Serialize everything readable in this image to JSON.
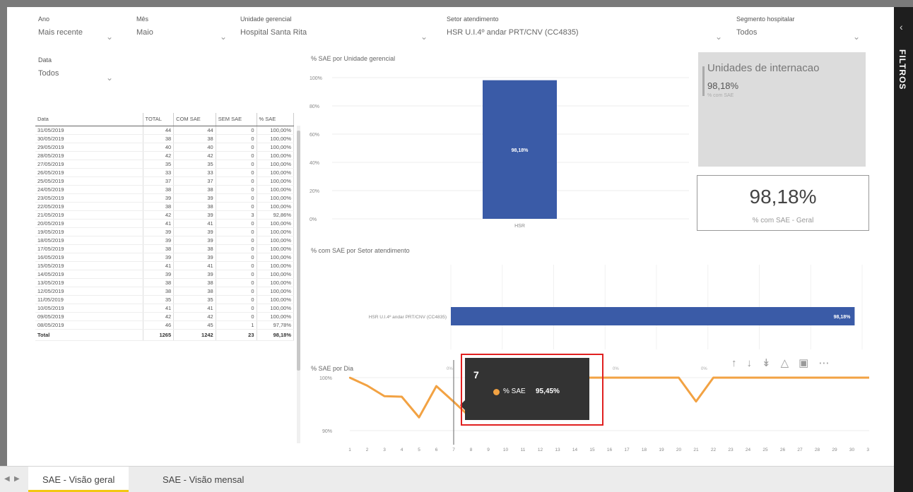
{
  "slicers": [
    {
      "label": "Ano",
      "value": "Mais recente"
    },
    {
      "label": "Mês",
      "value": "Maio"
    },
    {
      "label": "Unidade gerencial",
      "value": "Hospital Santa Rita"
    },
    {
      "label": "Setor atendimento",
      "value": "HSR U.I.4º andar PRT/CNV (CC4835)"
    },
    {
      "label": "Segmento hospitalar",
      "value": "Todos"
    },
    {
      "label": "Data",
      "value": "Todos"
    }
  ],
  "table": {
    "headers": [
      "Data",
      "TOTAL",
      "COM SAE",
      "SEM SAE",
      "% SAE"
    ],
    "rows": [
      [
        "31/05/2019",
        "44",
        "44",
        "0",
        "100,00%"
      ],
      [
        "30/05/2019",
        "38",
        "38",
        "0",
        "100,00%"
      ],
      [
        "29/05/2019",
        "40",
        "40",
        "0",
        "100,00%"
      ],
      [
        "28/05/2019",
        "42",
        "42",
        "0",
        "100,00%"
      ],
      [
        "27/05/2019",
        "35",
        "35",
        "0",
        "100,00%"
      ],
      [
        "26/05/2019",
        "33",
        "33",
        "0",
        "100,00%"
      ],
      [
        "25/05/2019",
        "37",
        "37",
        "0",
        "100,00%"
      ],
      [
        "24/05/2019",
        "38",
        "38",
        "0",
        "100,00%"
      ],
      [
        "23/05/2019",
        "39",
        "39",
        "0",
        "100,00%"
      ],
      [
        "22/05/2019",
        "38",
        "38",
        "0",
        "100,00%"
      ],
      [
        "21/05/2019",
        "42",
        "39",
        "3",
        "92,86%"
      ],
      [
        "20/05/2019",
        "41",
        "41",
        "0",
        "100,00%"
      ],
      [
        "19/05/2019",
        "39",
        "39",
        "0",
        "100,00%"
      ],
      [
        "18/05/2019",
        "39",
        "39",
        "0",
        "100,00%"
      ],
      [
        "17/05/2019",
        "38",
        "38",
        "0",
        "100,00%"
      ],
      [
        "16/05/2019",
        "39",
        "39",
        "0",
        "100,00%"
      ],
      [
        "15/05/2019",
        "41",
        "41",
        "0",
        "100,00%"
      ],
      [
        "14/05/2019",
        "39",
        "39",
        "0",
        "100,00%"
      ],
      [
        "13/05/2019",
        "38",
        "38",
        "0",
        "100,00%"
      ],
      [
        "12/05/2019",
        "38",
        "38",
        "0",
        "100,00%"
      ],
      [
        "11/05/2019",
        "35",
        "35",
        "0",
        "100,00%"
      ],
      [
        "10/05/2019",
        "41",
        "41",
        "0",
        "100,00%"
      ],
      [
        "09/05/2019",
        "42",
        "42",
        "0",
        "100,00%"
      ],
      [
        "08/05/2019",
        "46",
        "45",
        "1",
        "97,78%"
      ]
    ],
    "total": [
      "Total",
      "1265",
      "1242",
      "23",
      "98,18%"
    ]
  },
  "chart1": {
    "title": "% SAE por Unidade gerencial",
    "yticks": [
      "100%",
      "80%",
      "60%",
      "40%",
      "20%",
      "0%"
    ],
    "category": "HSR",
    "bar_label": "98,18%"
  },
  "card1": {
    "title": "Unidades de internacao",
    "value": "98,18%",
    "sub": "% com SAE"
  },
  "kpi": {
    "value": "98,18%",
    "sub": "% com SAE - Geral"
  },
  "chart2": {
    "title": "% com SAE por Setor atendimento",
    "category": "HSR U.I.4º andar PRT/CNV (CC4835)",
    "bar_label": "98,18%"
  },
  "chart3": {
    "title": "% SAE por Dia",
    "yticks": [
      "100%",
      "90%"
    ],
    "ref_labels": [
      "0%",
      "0%",
      "0%"
    ]
  },
  "tooltip": {
    "x": "7",
    "key": "% SAE",
    "value": "95,45%"
  },
  "tabs": [
    "SAE - Visão geral",
    "SAE - Visão mensal"
  ],
  "filters_pane": {
    "label": "FILTROS"
  },
  "colors": {
    "bar": "#3a5ba7",
    "line": "#f2a243",
    "tab_accent": "#f2c811"
  },
  "chart_data": [
    {
      "type": "bar",
      "title": "% SAE por Unidade gerencial",
      "categories": [
        "HSR"
      ],
      "values": [
        98.18
      ],
      "ylim": [
        0,
        100
      ]
    },
    {
      "type": "bar",
      "title": "% com SAE por Setor atendimento",
      "orientation": "horizontal",
      "categories": [
        "HSR U.I.4º andar PRT/CNV (CC4835)"
      ],
      "values": [
        98.18
      ],
      "xlim": [
        0,
        100
      ]
    },
    {
      "type": "line",
      "title": "% SAE por Dia",
      "x": [
        1,
        2,
        3,
        4,
        5,
        6,
        7,
        8,
        9,
        10,
        11,
        12,
        13,
        14,
        15,
        16,
        17,
        18,
        19,
        20,
        21,
        22,
        23,
        24,
        25,
        26,
        27,
        28,
        29,
        30,
        31
      ],
      "values": [
        100,
        98.5,
        96.5,
        96.4,
        92.5,
        98.4,
        95.45,
        92.4,
        98.4,
        100,
        100,
        100,
        100,
        100,
        100,
        100,
        100,
        100,
        100,
        100,
        95.5,
        100,
        100,
        100,
        100,
        100,
        100,
        100,
        100,
        100,
        100
      ],
      "ylim": [
        88,
        102
      ]
    }
  ]
}
